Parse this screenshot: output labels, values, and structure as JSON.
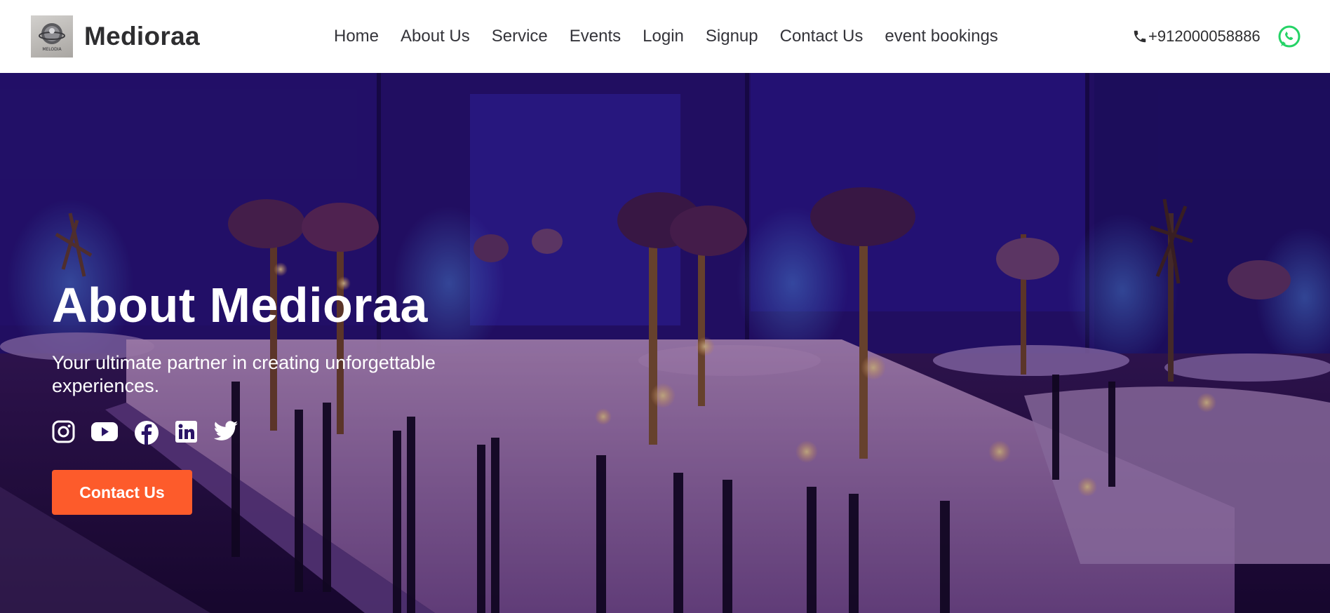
{
  "brand": {
    "name": "Medioraa",
    "logo_text": "MELODIA"
  },
  "nav": {
    "items": [
      {
        "label": "Home"
      },
      {
        "label": "About Us"
      },
      {
        "label": "Service"
      },
      {
        "label": "Events"
      },
      {
        "label": "Login"
      },
      {
        "label": "Signup"
      },
      {
        "label": "Contact Us"
      },
      {
        "label": "event bookings"
      }
    ]
  },
  "contact": {
    "phone": "+912000058886",
    "phone_icon": "phone-icon",
    "whatsapp_icon": "whatsapp-icon"
  },
  "hero": {
    "title": "About Medioraa",
    "subtitle": "Your ultimate partner in creating unforgettable experiences.",
    "cta_label": "Contact Us",
    "socials": [
      "instagram-icon",
      "youtube-icon",
      "facebook-icon",
      "linkedin-icon",
      "twitter-icon"
    ]
  },
  "colors": {
    "accent": "#fd5b2b",
    "whatsapp": "#25d366",
    "hero_tint": "#2c1378",
    "text_dark": "#34343a"
  }
}
